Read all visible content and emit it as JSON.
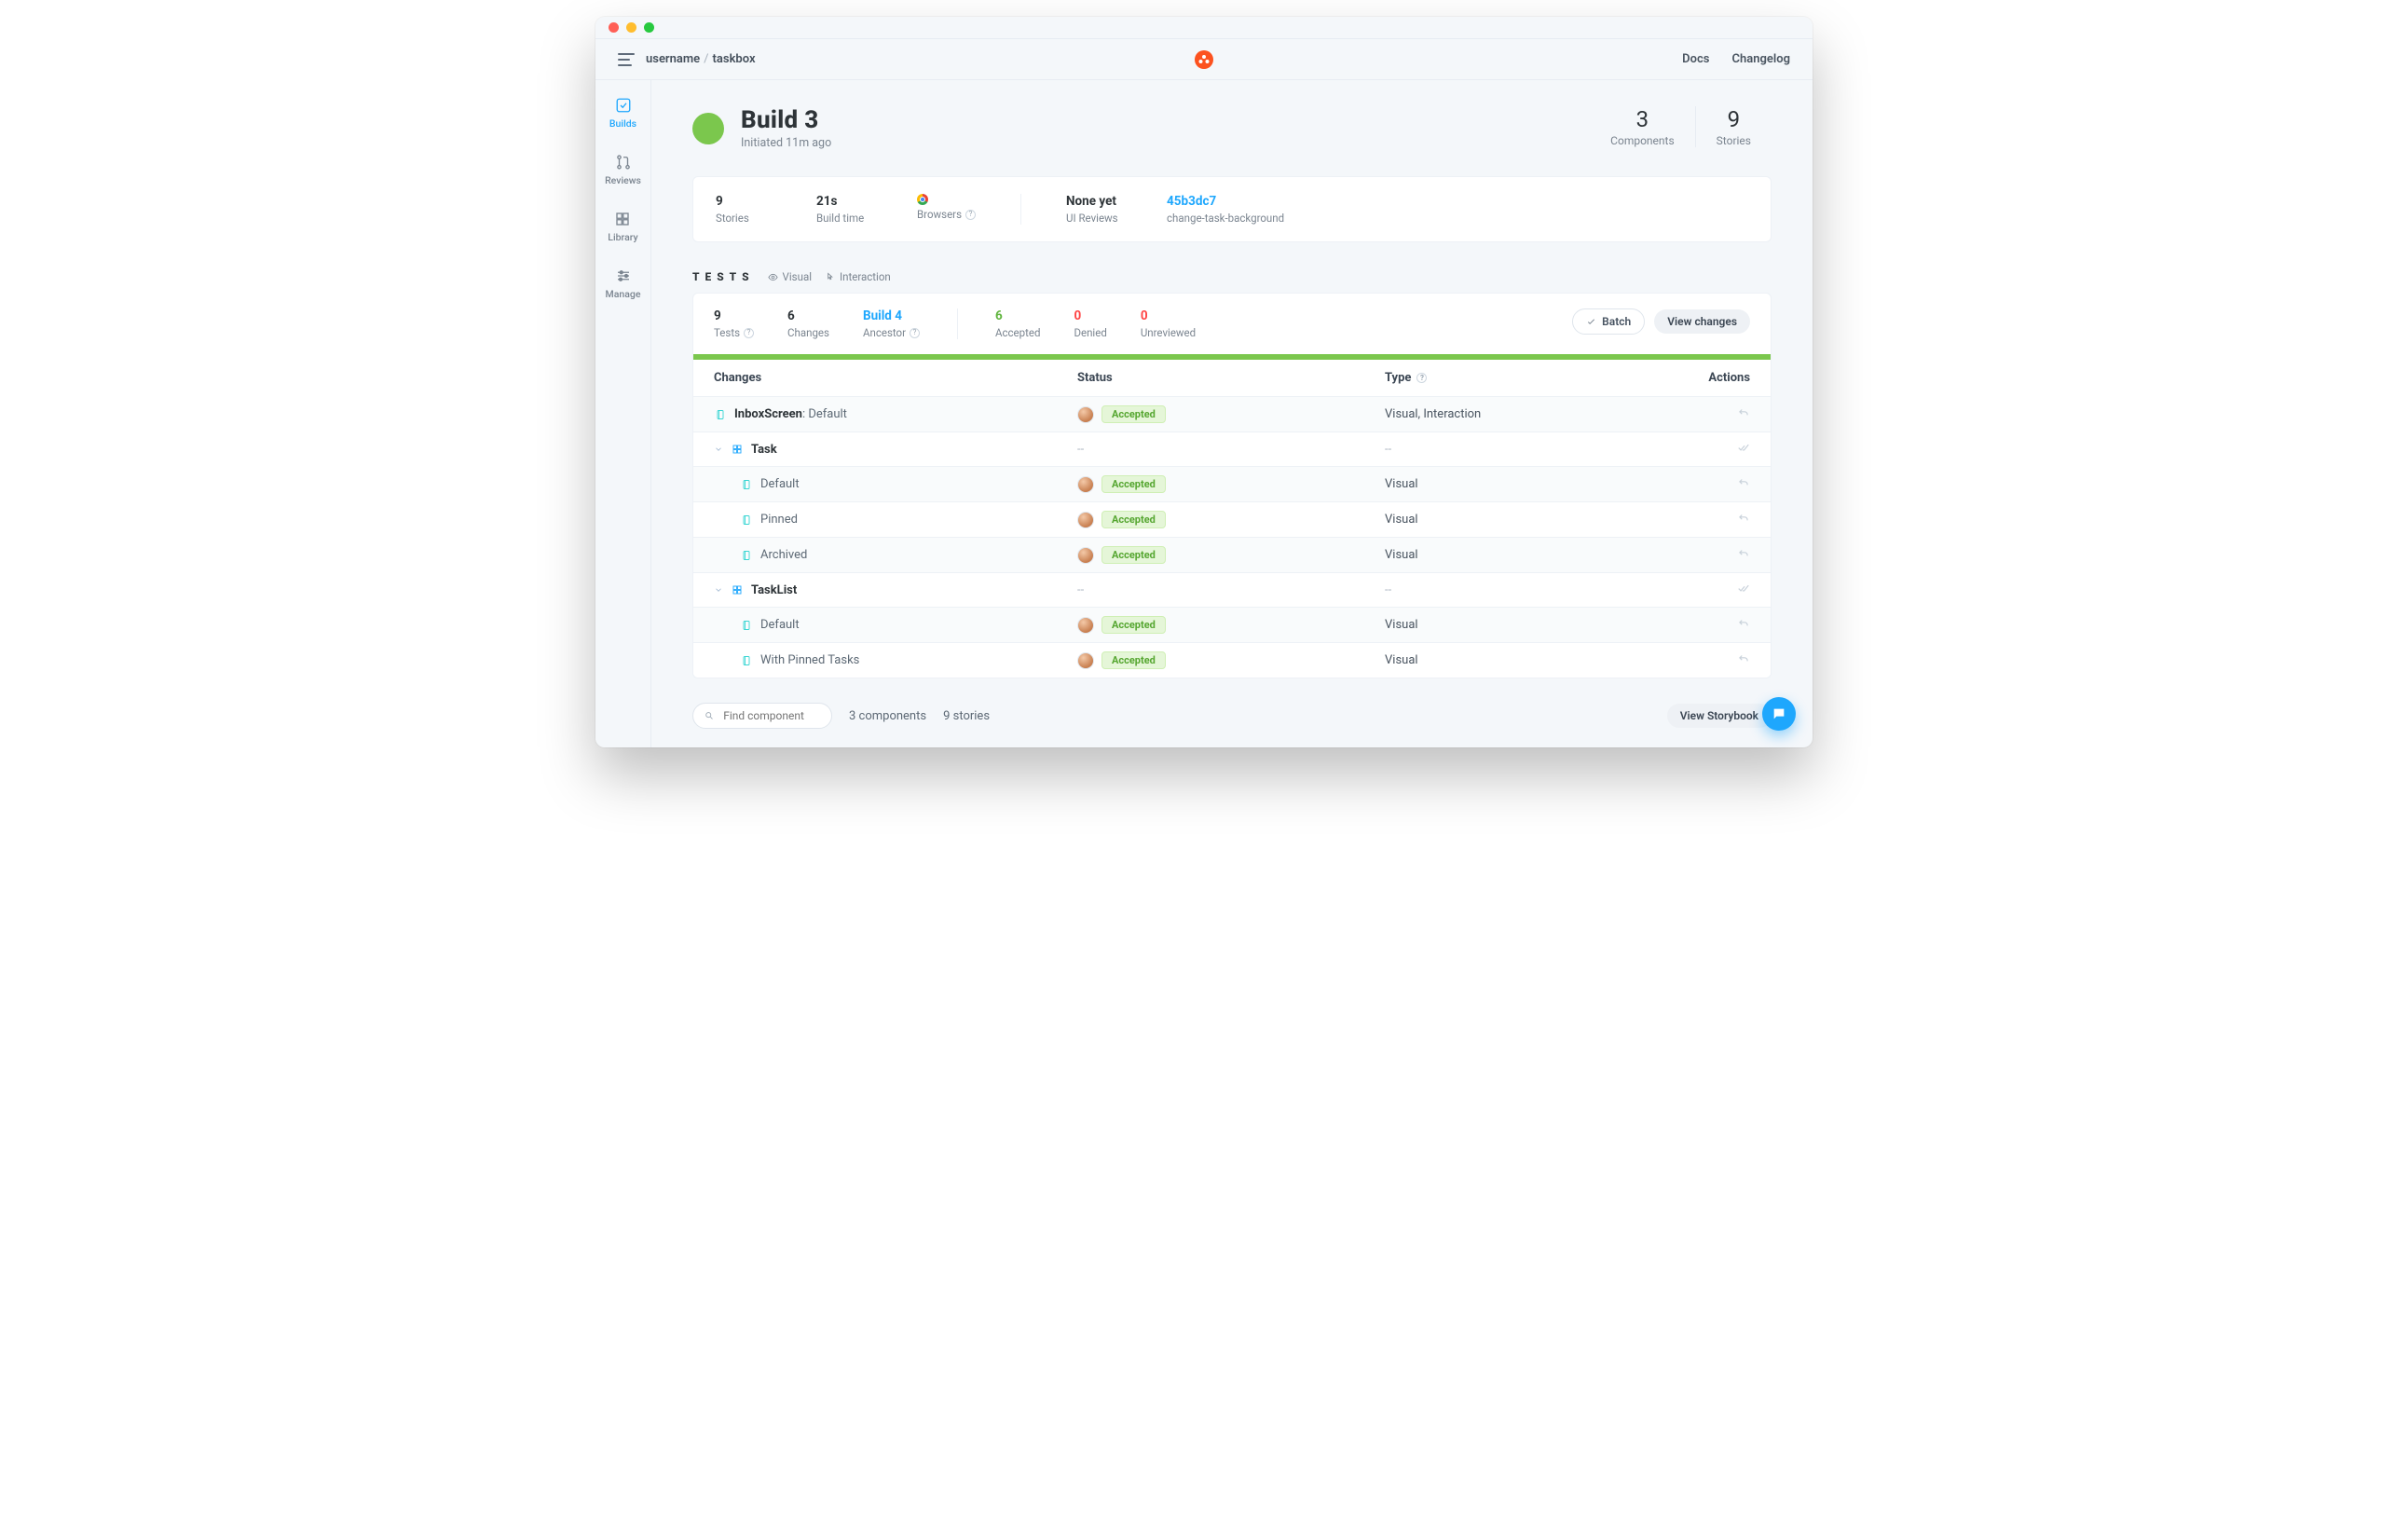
{
  "topbar": {
    "username": "username",
    "project": "taskbox",
    "nav": {
      "docs": "Docs",
      "changelog": "Changelog"
    }
  },
  "sidebar": {
    "builds": "Builds",
    "reviews": "Reviews",
    "library": "Library",
    "manage": "Manage"
  },
  "build": {
    "title": "Build 3",
    "subtitle": "Initiated 11m ago",
    "components": {
      "n": "3",
      "l": "Components"
    },
    "stories": {
      "n": "9",
      "l": "Stories"
    }
  },
  "summary": {
    "stories": {
      "v": "9",
      "s": "Stories"
    },
    "buildtime": {
      "v": "21s",
      "s": "Build time"
    },
    "browsers": {
      "s": "Browsers"
    },
    "uireviews": {
      "v": "None yet",
      "s": "UI Reviews"
    },
    "commit": {
      "v": "45b3dc7",
      "s": "change-task-background"
    }
  },
  "testsHeader": {
    "title": "TESTS",
    "visual": "Visual",
    "interaction": "Interaction"
  },
  "testsStats": {
    "tests": {
      "v": "9",
      "s": "Tests"
    },
    "changes": {
      "v": "6",
      "s": "Changes"
    },
    "ancestor": {
      "v": "Build 4",
      "s": "Ancestor"
    },
    "accepted": {
      "v": "6",
      "s": "Accepted"
    },
    "denied": {
      "v": "0",
      "s": "Denied"
    },
    "unreviewed": {
      "v": "0",
      "s": "Unreviewed"
    }
  },
  "buttons": {
    "batch": "Batch",
    "viewChanges": "View changes",
    "viewStorybook": "View Storybook"
  },
  "table": {
    "headers": {
      "changes": "Changes",
      "status": "Status",
      "type": "Type",
      "actions": "Actions"
    },
    "status_accepted": "Accepted",
    "type_visual": "Visual",
    "type_both": "Visual, Interaction",
    "rows": {
      "r1": {
        "name": "InboxScreen",
        "sub": ": Default"
      },
      "r2": {
        "name": "Task"
      },
      "r3": {
        "name": "Default"
      },
      "r4": {
        "name": "Pinned"
      },
      "r5": {
        "name": "Archived"
      },
      "r6": {
        "name": "TaskList"
      },
      "r7": {
        "name": "Default"
      },
      "r8": {
        "name": "With Pinned Tasks"
      }
    },
    "dash": "--"
  },
  "footer": {
    "searchPlaceholder": "Find component",
    "components": "3 components",
    "stories": "9 stories"
  }
}
